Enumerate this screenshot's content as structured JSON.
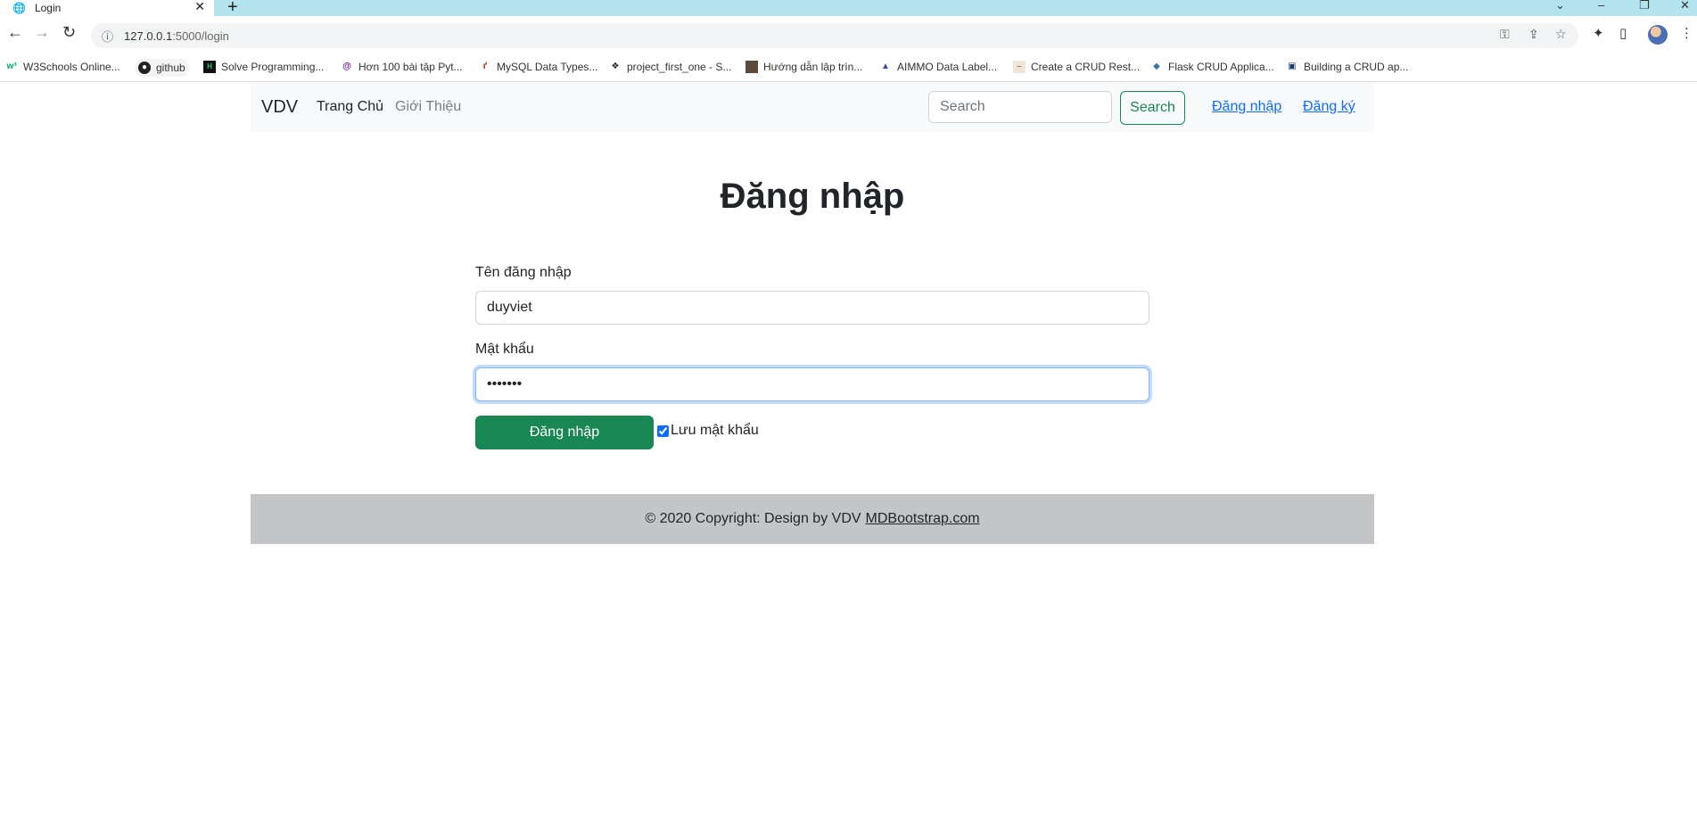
{
  "browser": {
    "tab_title": "Login",
    "url_host": "127.0.0.1",
    "url_path": ":5000/login",
    "bookmarks": [
      {
        "label": "W3Schools Online...",
        "icon": "w3schools-icon"
      },
      {
        "label": "github",
        "icon": "github-icon"
      },
      {
        "label": "Solve Programming...",
        "icon": "hackerrank-icon"
      },
      {
        "label": "Hơn 100 bài tập Pyt...",
        "icon": "at-icon"
      },
      {
        "label": "MySQL Data Types...",
        "icon": "mysql-icon"
      },
      {
        "label": "project_first_one - S...",
        "icon": "figma-icon"
      },
      {
        "label": "Hướng dẫn lập trìn...",
        "icon": "avatar-icon"
      },
      {
        "label": "AIMMO Data Label...",
        "icon": "aimmo-icon"
      },
      {
        "label": "Create a CRUD Rest...",
        "icon": "page-icon"
      },
      {
        "label": "Flask CRUD Applica...",
        "icon": "python-icon"
      },
      {
        "label": "Building a CRUD ap...",
        "icon": "site-icon"
      }
    ]
  },
  "navbar": {
    "brand": "VDV",
    "home": "Trang Chủ",
    "about": "Giới Thiệu",
    "search_placeholder": "Search",
    "search_button": "Search",
    "login": "Đăng nhập",
    "register": "Đăng ký"
  },
  "form": {
    "heading": "Đăng nhập",
    "username_label": "Tên đăng nhập",
    "username_value": "duyviet",
    "password_label": "Mật khẩu",
    "password_value": "•••••••",
    "submit": "Đăng nhập",
    "remember_label": "Lưu mật khẩu",
    "remember_checked": true
  },
  "footer": {
    "text": "© 2020 Copyright: Design by VDV",
    "link": "MDBootstrap.com"
  },
  "colors": {
    "primary_green": "#198754",
    "link_blue": "#0d6efd",
    "tabstrip": "#b3e3ee",
    "footer_bg": "#c4c5c7"
  }
}
